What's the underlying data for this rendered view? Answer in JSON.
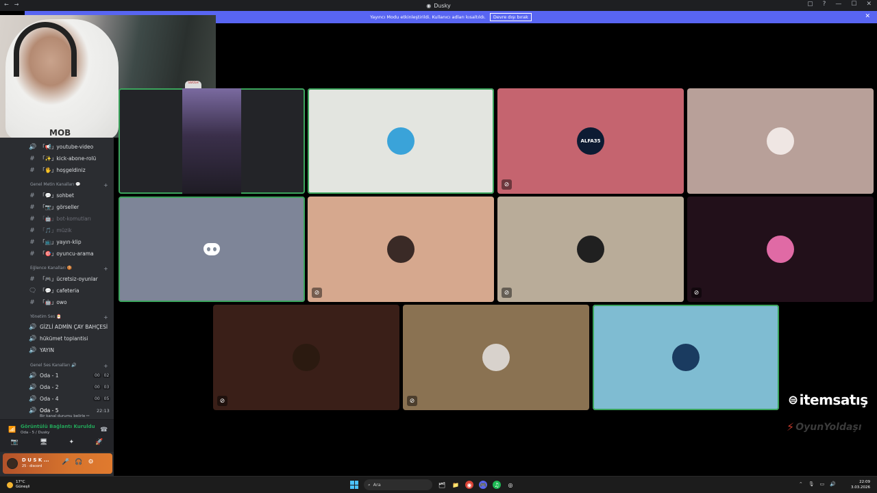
{
  "window": {
    "title": "Dusky",
    "controls": [
      "▢",
      "?",
      "—",
      "☐",
      "✕"
    ]
  },
  "banner": {
    "text": "Yayıncı Modu etkinleştirildi. Kullanıcı adları kısaltıldı.",
    "button": "Devre dışı bırak",
    "close": "✕"
  },
  "webcam": {
    "logo_text": "MOB",
    "plush_text": "SWOSH"
  },
  "sidebar": {
    "top_channels": [
      {
        "icon": "🔊",
        "label": "「📢」youtube-video"
      },
      {
        "icon": "#",
        "label": "「✨」kick-abone-rolü"
      },
      {
        "icon": "#",
        "label": "「🖐」hoşgeldiniz"
      }
    ],
    "cat_text": {
      "name": "Genel Metin Kanalları 💬",
      "plus": "+"
    },
    "text_channels": [
      {
        "icon": "#",
        "label": "「💬」sohbet",
        "muted": false
      },
      {
        "icon": "#",
        "label": "「📷」görseller",
        "muted": false
      },
      {
        "icon": "#",
        "label": "「🤖」bot-komutları",
        "muted": true
      },
      {
        "icon": "#",
        "label": "「🎵」müzik",
        "muted": true
      },
      {
        "icon": "#",
        "label": "「📺」yayın-klip",
        "muted": false
      },
      {
        "icon": "#",
        "label": "「🎯」oyuncu-arama",
        "muted": false
      }
    ],
    "cat_fun": {
      "name": "Eğlence Kanalları 🍪",
      "plus": "+"
    },
    "fun_channels": [
      {
        "icon": "#",
        "label": "「🎮」ücretsiz-oyunlar"
      },
      {
        "icon": "🗨",
        "label": "「💬」cafeteria"
      },
      {
        "icon": "#",
        "label": "「🤖」owo"
      }
    ],
    "cat_admin": {
      "name": "Yönetim Ses 🎅",
      "plus": "+"
    },
    "admin_channels": [
      {
        "icon": "🔊",
        "label": "GİZLİ ADMİN ÇAY BAHÇESİ"
      },
      {
        "icon": "🔊",
        "label": "hükümet toplantisi"
      },
      {
        "icon": "🔊",
        "label": "YAYIN"
      }
    ],
    "cat_voice": {
      "name": "Genel Ses Kanalları 🔊",
      "plus": "+"
    },
    "voice_channels": [
      {
        "icon": "🔊",
        "label": "Oda - 1",
        "c1": "00",
        "c2": "02"
      },
      {
        "icon": "🔊",
        "label": "Oda - 2",
        "c1": "00",
        "c2": "03"
      },
      {
        "icon": "🔊",
        "label": "Oda - 4",
        "c1": "00",
        "c2": "05"
      }
    ],
    "active_voice": {
      "icon": "🔊",
      "label": "Oda - 5",
      "time": "22:13",
      "status": "Bir kanal durumu belirle ✏"
    }
  },
  "voice_panel": {
    "status": "Görüntülü Bağlantı Kuruldu",
    "sub": "Oda - 5 / Dusky",
    "icons": [
      "📶",
      "☎"
    ],
    "buttons": [
      "📷",
      "🖥",
      "✦",
      "🚀"
    ]
  },
  "user_panel": {
    "name": "D U S K ...",
    "sub": "25 · discord",
    "controls": [
      "🎤",
      "🎧",
      "⚙"
    ]
  },
  "tiles": [
    {
      "bg": "#232428",
      "speaking": true,
      "type": "stream",
      "muted": false
    },
    {
      "bg": "#e3e5e0",
      "speaking": true,
      "type": "avatar",
      "av_bg": "#3aa3d9",
      "av_text": "",
      "muted": false
    },
    {
      "bg": "#c5646f",
      "speaking": false,
      "type": "avatar",
      "av_bg": "#0d1b33",
      "av_text": "ALFA35",
      "muted": true
    },
    {
      "bg": "#b8a099",
      "speaking": false,
      "type": "avatar",
      "av_bg": "#efe6e3",
      "av_text": "",
      "muted": false
    },
    {
      "bg": "#7e8598",
      "speaking": true,
      "type": "discord",
      "muted": false
    },
    {
      "bg": "#d6a88e",
      "speaking": false,
      "type": "avatar",
      "av_bg": "#3a2a26",
      "av_text": "",
      "muted": true
    },
    {
      "bg": "#b9ac99",
      "speaking": false,
      "type": "avatar",
      "av_bg": "#202020",
      "av_text": "",
      "muted": true
    },
    {
      "bg": "#22101a",
      "speaking": false,
      "type": "avatar",
      "av_bg": "#e06aa5",
      "av_text": "",
      "muted": true
    },
    {
      "bg": "#3a1f18",
      "speaking": false,
      "type": "avatar",
      "av_bg": "#2b1a10",
      "av_text": "",
      "muted": true
    },
    {
      "bg": "#8a7252",
      "speaking": false,
      "type": "avatar",
      "av_bg": "#d8d2cc",
      "av_text": "",
      "muted": true
    },
    {
      "bg": "#7fbcd2",
      "speaking": true,
      "type": "avatar",
      "av_bg": "#1a3b60",
      "av_text": "",
      "muted": false
    }
  ],
  "mute_glyph": "🎙̸",
  "brand": {
    "itemsatis": "itemsatış",
    "itemsatis_mark": "⊜",
    "second": "OyunYoldaşı",
    "second_mark": "⚡"
  },
  "taskbar": {
    "temp": "17°C",
    "weather": "Güneşli",
    "search": "Ara",
    "apps": [
      "🗂",
      "📁",
      "◉",
      "🎮",
      "♫",
      "◎"
    ],
    "tray": [
      "⌃",
      "🎙",
      "▭",
      "🔊"
    ],
    "time": "22:09",
    "date": "3.03.2026"
  }
}
